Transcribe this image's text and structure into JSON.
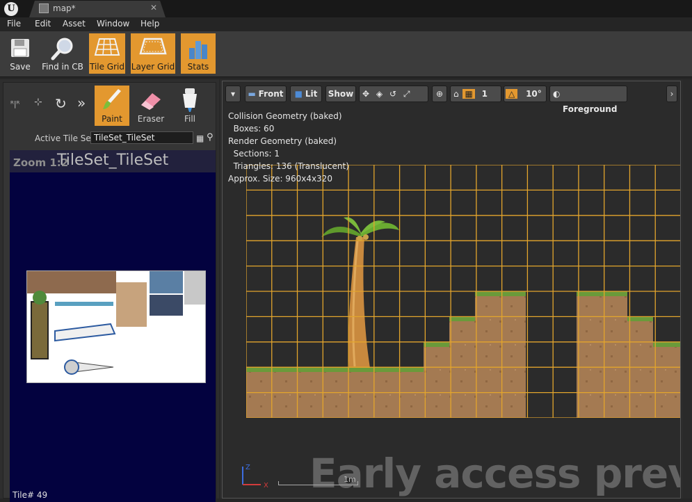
{
  "window": {
    "tab_title": "map*",
    "logo_letter": "U"
  },
  "menu": {
    "items": [
      "File",
      "Edit",
      "Asset",
      "Window",
      "Help"
    ]
  },
  "toolbar": {
    "buttons": [
      {
        "label": "Save",
        "icon": "save-icon",
        "active": false
      },
      {
        "label": "Find in CB",
        "icon": "magnifier-icon",
        "active": false
      },
      {
        "label": "Tile Grid",
        "icon": "tile-grid-icon",
        "active": true
      },
      {
        "label": "Layer Grid",
        "icon": "layer-grid-icon",
        "active": true
      },
      {
        "label": "Stats",
        "icon": "stats-icon",
        "active": true
      }
    ]
  },
  "tools": {
    "items": [
      {
        "label": "Paint",
        "icon": "brush-icon",
        "active": true
      },
      {
        "label": "Eraser",
        "icon": "eraser-icon",
        "active": false
      },
      {
        "label": "Fill",
        "icon": "paint-bucket-icon",
        "active": false
      }
    ]
  },
  "tileset": {
    "active_label": "Active Tile Set",
    "active_value": "TileSet_TileSet",
    "zoom": "Zoom 1:2",
    "name": "TileSet_TileSet",
    "tile_number": "Tile# 49"
  },
  "viewport": {
    "view_mode": "Front",
    "lighting": "Lit",
    "show": "Show",
    "grid_snap": "1",
    "rotation_snap": "10°",
    "layer": "Foreground",
    "stats": [
      "Collision Geometry (baked)",
      "  Boxes: 60",
      "Render Geometry (baked)",
      "  Sections: 1",
      "  Triangles: 136 (Translucent)",
      "Approx. Size: 960x4x320"
    ],
    "watermark": "Early access preview",
    "scale_label": "1m",
    "axis_z": "Z",
    "axis_x": "X"
  },
  "colors": {
    "accent": "#e3982f",
    "tileset_bg": "#03023f",
    "grid_line": "#e3a52c"
  }
}
